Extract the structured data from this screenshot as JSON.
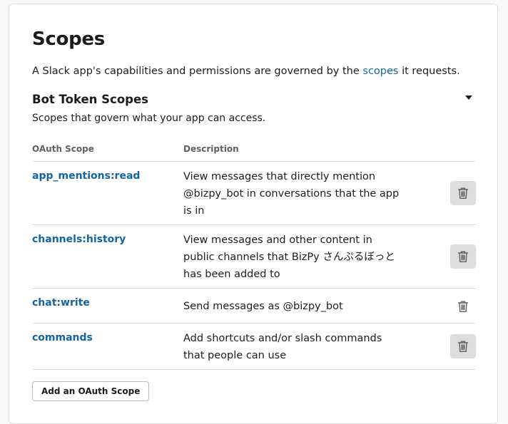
{
  "page": {
    "title": "Scopes",
    "intro_before": "A Slack app's capabilities and permissions are governed by the ",
    "intro_link": "scopes",
    "intro_after": " it requests."
  },
  "section": {
    "title": "Bot Token Scopes",
    "description": "Scopes that govern what your app can access."
  },
  "table": {
    "col_scope": "OAuth Scope",
    "col_description": "Description",
    "rows": [
      {
        "scope": "app_mentions:read",
        "description": "View messages that directly mention @bizpy_bot in conversations that the app is in"
      },
      {
        "scope": "channels:history",
        "description": "View messages and other content in public channels that BizPy さんぷるぼっと has been added to"
      },
      {
        "scope": "chat:write",
        "description": "Send messages as @bizpy_bot"
      },
      {
        "scope": "commands",
        "description": "Add shortcuts and/or slash commands that people can use"
      }
    ]
  },
  "add_button": "Add an OAuth Scope",
  "colors": {
    "link": "#1264a3",
    "text": "#1d1c1d",
    "divider": "#dddddd"
  },
  "icons": {
    "delete": "trash-icon",
    "toggle": "caret-down-icon"
  }
}
